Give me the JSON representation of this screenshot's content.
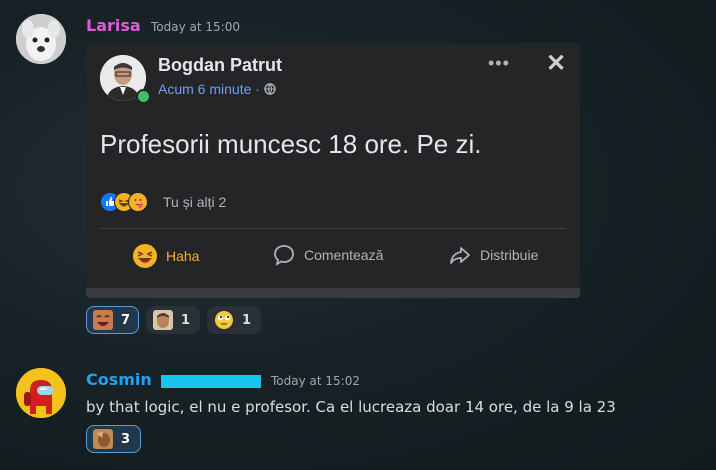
{
  "messages": [
    {
      "username": "Larisa",
      "username_color": "#e05bd8",
      "timestamp": "Today at 15:00",
      "embed": {
        "author": "Bogdan Patrut",
        "time": "Acum 6 minute · ",
        "more": "•••",
        "close": "✕",
        "text": "Profesorii muncesc 18 ore. Pe zi.",
        "reactions_summary": "Tu și alți 2",
        "actions": [
          {
            "label": "Haha",
            "icon": "haha-emoji-icon"
          },
          {
            "label": "Comentează",
            "icon": "comment-icon"
          },
          {
            "label": "Distribuie",
            "icon": "share-icon"
          }
        ]
      },
      "reactions": [
        {
          "emoji": "laughing-face-emoji",
          "count": "7",
          "active": true
        },
        {
          "emoji": "custom-face-emoji",
          "count": "1",
          "active": false
        },
        {
          "emoji": "rolling-eyes-emoji",
          "count": "1",
          "active": false
        }
      ]
    },
    {
      "username": "Cosmin",
      "username_color": "#1ea2f2",
      "timestamp": "Today at 15:02",
      "text": "by that logic, el nu e profesor. Ca el lucreaza doar 14 ore, de la 9 la 23",
      "reactions": [
        {
          "emoji": "custom-face-emoji",
          "count": "3",
          "active": true
        }
      ]
    }
  ]
}
